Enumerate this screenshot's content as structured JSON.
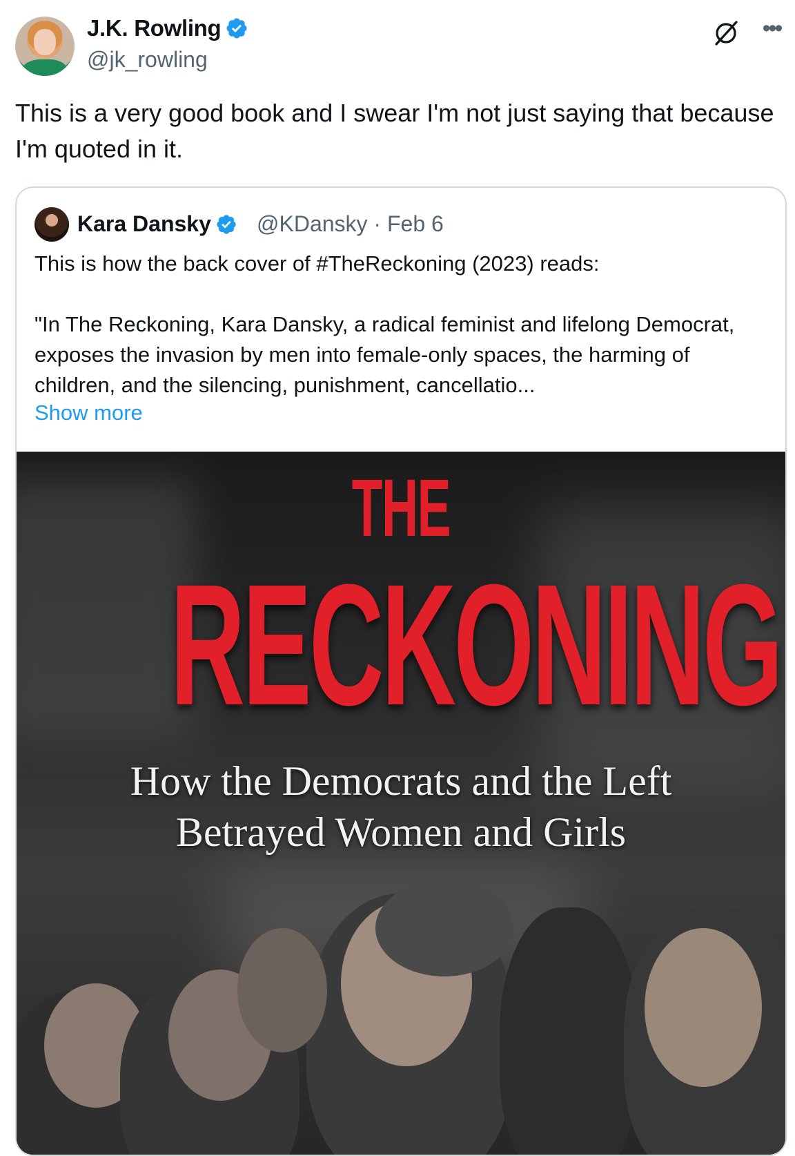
{
  "tweet": {
    "author_name": "J.K. Rowling",
    "author_handle": "@jk_rowling",
    "text": "This is a very good book and I swear I'm not just saying that because I'm quoted in it."
  },
  "quote": {
    "author_name": "Kara Dansky",
    "author_handle": "@KDansky",
    "separator": "·",
    "date": "Feb 6",
    "text": "This is how the back cover of #TheReckoning (2023) reads:\n\n\"In The Reckoning, Kara Dansky, a radical feminist and lifelong Democrat, exposes the invasion by men into female-only spaces, the harming of children, and the silencing, punishment, cancellatio...",
    "show_more": "Show more"
  },
  "cover": {
    "title_small": "THE",
    "title_large": "RECKONING",
    "subtitle_line1": "How the Democrats and the Left",
    "subtitle_line2": "Betrayed Women and Girls"
  },
  "colors": {
    "verified_blue": "#1d9bf0",
    "title_red": "#e2202a",
    "muted": "#536471"
  },
  "icons": [
    "verified-badge-icon",
    "grok-icon",
    "more-options-icon"
  ]
}
